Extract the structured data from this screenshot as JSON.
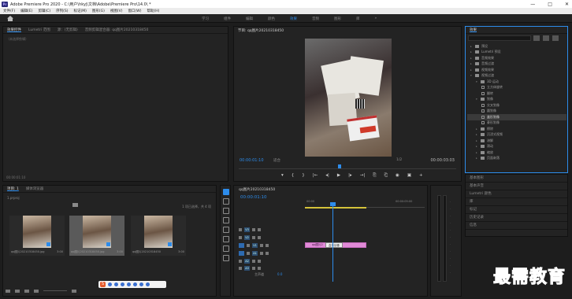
{
  "titlebar": {
    "app_badge": "Pr",
    "title": "Adobe Premiere Pro 2020 - C:\\用户\\hkyj\\文档\\Adobe\\Premiere Pro\\14.0\\ *",
    "minimize": "—",
    "maximize": "□",
    "close": "✕"
  },
  "menubar": [
    "文件(F)",
    "编辑(E)",
    "剪辑(C)",
    "序列(S)",
    "标记(M)",
    "图形(G)",
    "视图(V)",
    "窗口(W)",
    "帮助(H)"
  ],
  "workspace": {
    "tabs": [
      {
        "label": "学习",
        "active": false
      },
      {
        "label": "组件",
        "active": false
      },
      {
        "label": "编辑",
        "active": false
      },
      {
        "label": "颜色",
        "active": false
      },
      {
        "label": "效果",
        "active": true
      },
      {
        "label": "音频",
        "active": false
      },
      {
        "label": "图形",
        "active": false
      },
      {
        "label": "库",
        "active": false
      },
      {
        "label": "»",
        "active": false
      }
    ]
  },
  "source_panel": {
    "tabs": [
      {
        "label": "效果控件",
        "on": true
      },
      {
        "label": "Lumetri 范围",
        "on": false
      },
      {
        "label": "源：(无剪辑)",
        "on": false
      },
      {
        "label": "音频剪辑混合器: qq图片20210318450",
        "on": false
      }
    ],
    "placeholder": "（未选择剪辑）",
    "timecode": "00:00:01:10"
  },
  "program_panel": {
    "title": "节目: qq图片20210318450",
    "timecode_left": "00:00:01:10",
    "fit": "适合",
    "resolution": "1/2",
    "timecode_right": "00:00:03:03",
    "controls": [
      "▾",
      "{",
      "}",
      "|←",
      "◂|",
      "▶",
      "|▸",
      "→|",
      "⎘",
      "⎗",
      "◉",
      "▣",
      "+"
    ]
  },
  "effects_panel": {
    "title": "效果",
    "tree": [
      {
        "label": "预设",
        "level": 0,
        "type": "folder",
        "open": false,
        "selected": false
      },
      {
        "label": "Lumetri 预设",
        "level": 0,
        "type": "folder",
        "open": false,
        "selected": false
      },
      {
        "label": "音频效果",
        "level": 0,
        "type": "folder",
        "open": false,
        "selected": false
      },
      {
        "label": "音频过渡",
        "level": 0,
        "type": "folder",
        "open": false,
        "selected": false
      },
      {
        "label": "视频效果",
        "level": 0,
        "type": "folder",
        "open": false,
        "selected": false
      },
      {
        "label": "视频过渡",
        "level": 0,
        "type": "folder",
        "open": true,
        "selected": false
      },
      {
        "label": "3D 运动",
        "level": 1,
        "type": "folder",
        "open": true,
        "selected": false
      },
      {
        "label": "立方体旋转",
        "level": 2,
        "type": "fx",
        "open": false,
        "selected": false
      },
      {
        "label": "翻转",
        "level": 2,
        "type": "fx",
        "open": false,
        "selected": false
      },
      {
        "label": "划像",
        "level": 1,
        "type": "folder",
        "open": true,
        "selected": false
      },
      {
        "label": "交叉划像",
        "level": 2,
        "type": "fx",
        "open": false,
        "selected": false
      },
      {
        "label": "圆划像",
        "level": 2,
        "type": "fx",
        "open": false,
        "selected": false
      },
      {
        "label": "盒形划像",
        "level": 2,
        "type": "fx",
        "open": false,
        "selected": true
      },
      {
        "label": "菱形划像",
        "level": 2,
        "type": "fx",
        "open": false,
        "selected": false
      },
      {
        "label": "擦除",
        "level": 1,
        "type": "folder",
        "open": false,
        "selected": false
      },
      {
        "label": "沉浸式视频",
        "level": 1,
        "type": "folder",
        "open": false,
        "selected": false
      },
      {
        "label": "溶解",
        "level": 1,
        "type": "folder",
        "open": false,
        "selected": false
      },
      {
        "label": "滑动",
        "level": 1,
        "type": "folder",
        "open": false,
        "selected": false
      },
      {
        "label": "缩放",
        "level": 1,
        "type": "folder",
        "open": false,
        "selected": false
      },
      {
        "label": "页面剥落",
        "level": 1,
        "type": "folder",
        "open": false,
        "selected": false
      }
    ]
  },
  "side_list": [
    "基本图形",
    "基本声音",
    "Lumetri 颜色",
    "库",
    "标记",
    "历史记录",
    "信息"
  ],
  "project_panel": {
    "tabs": [
      {
        "label": "项目: 1",
        "on": true
      },
      {
        "label": "媒体浏览器",
        "on": false
      }
    ],
    "project_name": "1.prproj",
    "count": "1 项已选择，共 4 项",
    "items": [
      {
        "name": "qq图片20210318450.jpg",
        "duration": "3:00",
        "selected": false
      },
      {
        "name": "qq图片20210318450.jpg",
        "duration": "3:00",
        "selected": true
      },
      {
        "name": "qq图片20210318450",
        "duration": "3:00",
        "selected": false
      }
    ],
    "ime_glyph": "S"
  },
  "timeline_panel": {
    "title": "qq图片20210318450",
    "timecode": "00:00:01:10",
    "ruler_start": "00:00",
    "ruler_end": "00:00:05:00",
    "tracks": [
      {
        "label": "V3"
      },
      {
        "label": "V2"
      },
      {
        "label": "V1"
      },
      {
        "label": "A1"
      },
      {
        "label": "A2"
      },
      {
        "label": "A3"
      }
    ],
    "clip_label": "qq图片2",
    "transition_label": "盒形划像",
    "master_label": "主声道",
    "master_value": "0.0"
  },
  "watermark": "最需教育"
}
